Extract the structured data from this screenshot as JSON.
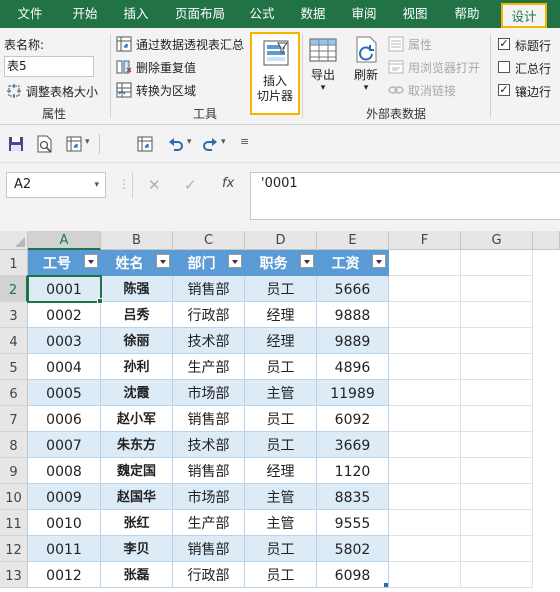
{
  "menu": [
    "文件",
    "开始",
    "插入",
    "页面布局",
    "公式",
    "数据",
    "审阅",
    "视图",
    "帮助",
    "设计"
  ],
  "ribbon": {
    "properties": {
      "table_name_label": "表名称:",
      "table_name_value": "表5",
      "resize_label": "调整表格大小",
      "group_label": "属性"
    },
    "tools": {
      "pivot_label": "通过数据透视表汇总",
      "remove_dup_label": "删除重复值",
      "convert_label": "转换为区域",
      "slicer_line1": "插入",
      "slicer_line2": "切片器",
      "group_label": "工具"
    },
    "external": {
      "export_label": "导出",
      "refresh_label": "刷新",
      "props_label": "属性",
      "browser_label": "用浏览器打开",
      "unlink_label": "取消链接",
      "group_label": "外部表数据"
    },
    "style_options": {
      "header_row": "标题行",
      "total_row": "汇总行",
      "banded_rows": "镶边行",
      "header_checked": true,
      "total_checked": false,
      "banded_checked": true
    }
  },
  "formula_bar": {
    "name_box": "A2",
    "fx": "fx",
    "content": "'0001"
  },
  "grid": {
    "columns": [
      "A",
      "B",
      "C",
      "D",
      "E",
      "F",
      "G"
    ],
    "rows": [
      "1",
      "2",
      "3",
      "4",
      "5",
      "6",
      "7",
      "8",
      "9",
      "10",
      "11",
      "12",
      "13"
    ],
    "headers": [
      "工号",
      "姓名",
      "部门",
      "职务",
      "工资"
    ],
    "data": [
      [
        "0001",
        "陈强",
        "销售部",
        "员工",
        "5666"
      ],
      [
        "0002",
        "吕秀",
        "行政部",
        "经理",
        "9888"
      ],
      [
        "0003",
        "徐丽",
        "技术部",
        "经理",
        "9889"
      ],
      [
        "0004",
        "孙利",
        "生产部",
        "员工",
        "4896"
      ],
      [
        "0005",
        "沈霞",
        "市场部",
        "主管",
        "11989"
      ],
      [
        "0006",
        "赵小军",
        "销售部",
        "员工",
        "6092"
      ],
      [
        "0007",
        "朱东方",
        "技术部",
        "员工",
        "3669"
      ],
      [
        "0008",
        "魏定国",
        "销售部",
        "经理",
        "1120"
      ],
      [
        "0009",
        "赵国华",
        "市场部",
        "主管",
        "8835"
      ],
      [
        "0010",
        "张红",
        "生产部",
        "主管",
        "9555"
      ],
      [
        "0011",
        "李贝",
        "销售部",
        "员工",
        "5802"
      ],
      [
        "0012",
        "张磊",
        "行政部",
        "员工",
        "6098"
      ]
    ]
  },
  "colors": {
    "accent": "#217346",
    "table_header": "#5b9bd5",
    "table_band": "#ddebf7",
    "highlight": "#f5b400"
  }
}
